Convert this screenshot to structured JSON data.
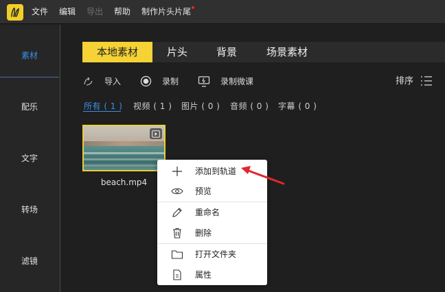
{
  "menubar": {
    "items": [
      "文件",
      "编辑",
      "导出",
      "帮助",
      "制作片头片尾"
    ],
    "disabled_item": "导出"
  },
  "leftnav": {
    "items": [
      "素材",
      "配乐",
      "文字",
      "转场",
      "滤镜"
    ],
    "active": "素材"
  },
  "tabs": [
    "本地素材",
    "片头",
    "背景",
    "场景素材"
  ],
  "active_tab": "本地素材",
  "toolbar": {
    "import_label": "导入",
    "record_label": "录制",
    "record_lesson_label": "录制微课",
    "sort_label": "排序"
  },
  "filters": [
    "所有 ( 1 )",
    "视频 ( 1 )",
    "图片 ( 0 )",
    "音频 ( 0 )",
    "字幕 ( 0 )"
  ],
  "active_filter": "所有 ( 1 )",
  "media": [
    {
      "filename": "beach.mp4",
      "type_icon": "video-badge-icon"
    }
  ],
  "context_menu": {
    "items": [
      {
        "label": "添加到轨道",
        "icon": "plus-icon"
      },
      {
        "label": "预览",
        "icon": "eye-icon"
      },
      {
        "label": "重命名",
        "icon": "pencil-icon"
      },
      {
        "label": "删除",
        "icon": "trash-icon"
      },
      {
        "label": "打开文件夹",
        "icon": "folder-icon"
      },
      {
        "label": "属性",
        "icon": "document-icon"
      }
    ]
  },
  "colors": {
    "accent_yellow": "#f5d235",
    "accent_blue": "#3b8fe6",
    "annotation_red": "#e0282e"
  }
}
